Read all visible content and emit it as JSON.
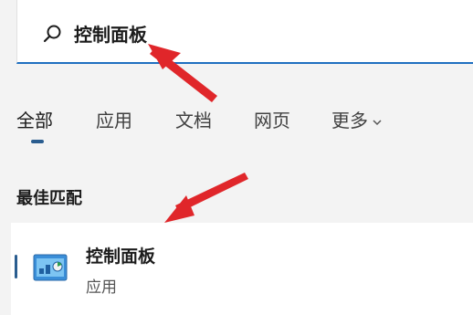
{
  "search": {
    "query": "控制面板"
  },
  "tabs": [
    {
      "label": "全部",
      "active": true
    },
    {
      "label": "应用"
    },
    {
      "label": "文档"
    },
    {
      "label": "网页"
    },
    {
      "label": "更多"
    }
  ],
  "best_match": {
    "title": "最佳匹配",
    "item": {
      "name": "控制面板",
      "type": "应用",
      "icon": "control-panel-icon"
    }
  },
  "colors": {
    "accent": "#2a5d8f",
    "annotation_arrow": "#e0262a"
  }
}
